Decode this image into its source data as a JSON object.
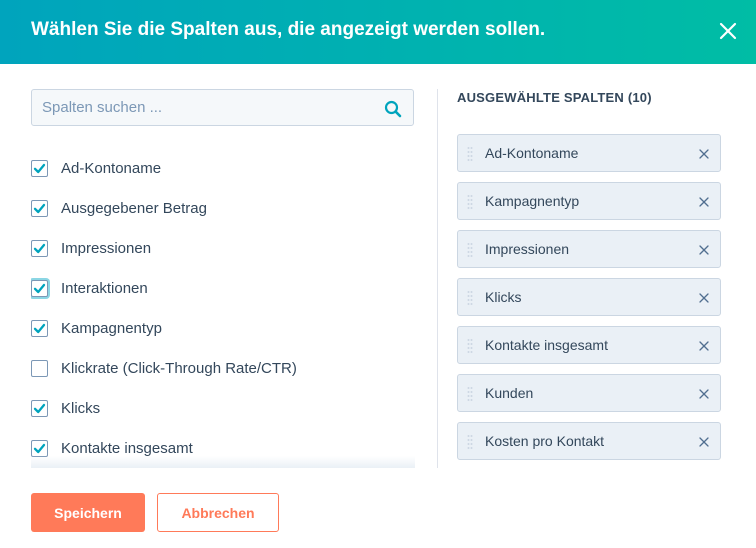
{
  "dialog": {
    "title": "Wählen Sie die Spalten aus, die angezeigt werden sollen.",
    "close_icon": "close-icon"
  },
  "search": {
    "placeholder": "Spalten suchen ...",
    "icon": "search-icon"
  },
  "columns": [
    {
      "label": "Ad-Kontoname",
      "checked": true
    },
    {
      "label": "Ausgegebener Betrag",
      "checked": true
    },
    {
      "label": "Impressionen",
      "checked": true
    },
    {
      "label": "Interaktionen",
      "checked": true,
      "focused": true
    },
    {
      "label": "Kampagnentyp",
      "checked": true
    },
    {
      "label": "Klickrate (Click-Through Rate/CTR)",
      "checked": false
    },
    {
      "label": "Klicks",
      "checked": true
    },
    {
      "label": "Kontakte insgesamt",
      "checked": true
    }
  ],
  "selected": {
    "heading": "AUSGEWÄHLTE SPALTEN (10)",
    "items": [
      {
        "label": "Ad-Kontoname"
      },
      {
        "label": "Kampagnentyp"
      },
      {
        "label": "Impressionen"
      },
      {
        "label": "Klicks"
      },
      {
        "label": "Kontakte insgesamt"
      },
      {
        "label": "Kunden"
      },
      {
        "label": "Kosten pro Kontakt"
      }
    ]
  },
  "footer": {
    "save_label": "Speichern",
    "cancel_label": "Abbrechen"
  },
  "colors": {
    "header_start": "#00a4bd",
    "header_end": "#00bda5",
    "checkbox_check": "#00a4bd",
    "primary_button": "#ff7a59",
    "chip_background": "#eaf0f6"
  }
}
